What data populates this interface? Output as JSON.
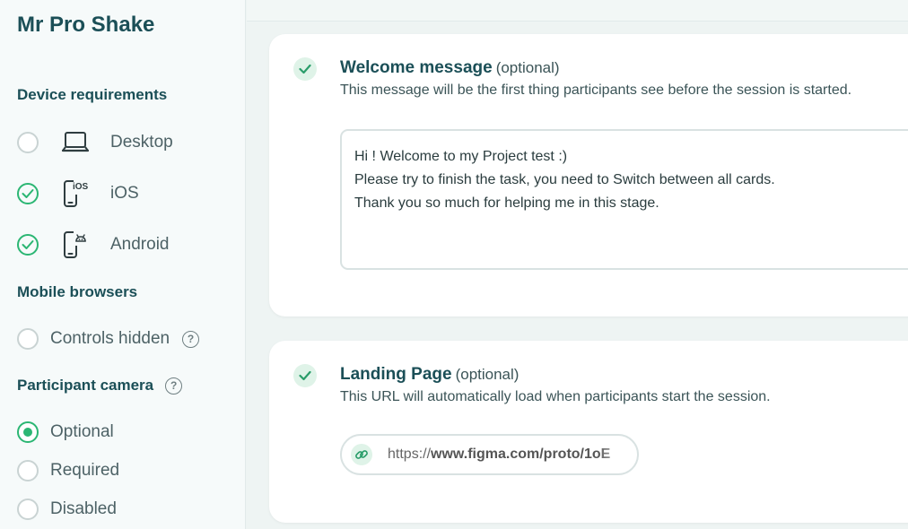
{
  "sidebar": {
    "project_title": "Mr Pro Shake",
    "device_requirements": {
      "title": "Device requirements",
      "items": [
        {
          "label": "Desktop",
          "icon": "laptop-icon",
          "checked": false
        },
        {
          "label": "iOS",
          "icon": "ios-phone-icon",
          "checked": true
        },
        {
          "label": "Android",
          "icon": "android-phone-icon",
          "checked": true
        }
      ]
    },
    "mobile_browsers": {
      "title": "Mobile browsers",
      "items": [
        {
          "label": "Controls hidden",
          "selected": false
        }
      ]
    },
    "participant_camera": {
      "title": "Participant camera",
      "options": [
        {
          "label": "Optional",
          "selected": true
        },
        {
          "label": "Required",
          "selected": false
        },
        {
          "label": "Disabled",
          "selected": false
        }
      ]
    }
  },
  "welcome_card": {
    "title": "Welcome message",
    "optional": "(optional)",
    "description": "This message will be the first thing participants see before the session is started.",
    "message_lines": [
      "Hi ! Welcome to my Project test :)",
      "Please try to finish the task, you need to Switch between all cards.",
      "Thank you so much for helping me in this stage."
    ]
  },
  "landing_card": {
    "title": "Landing Page",
    "optional": "(optional)",
    "description": "This URL will automatically load when participants start the session.",
    "url_scheme": "https://",
    "url_rest": "www.figma.com/proto/1oE"
  },
  "colors": {
    "accent": "#2bb673",
    "heading": "#1b4f57",
    "background": "#eef4f3"
  }
}
